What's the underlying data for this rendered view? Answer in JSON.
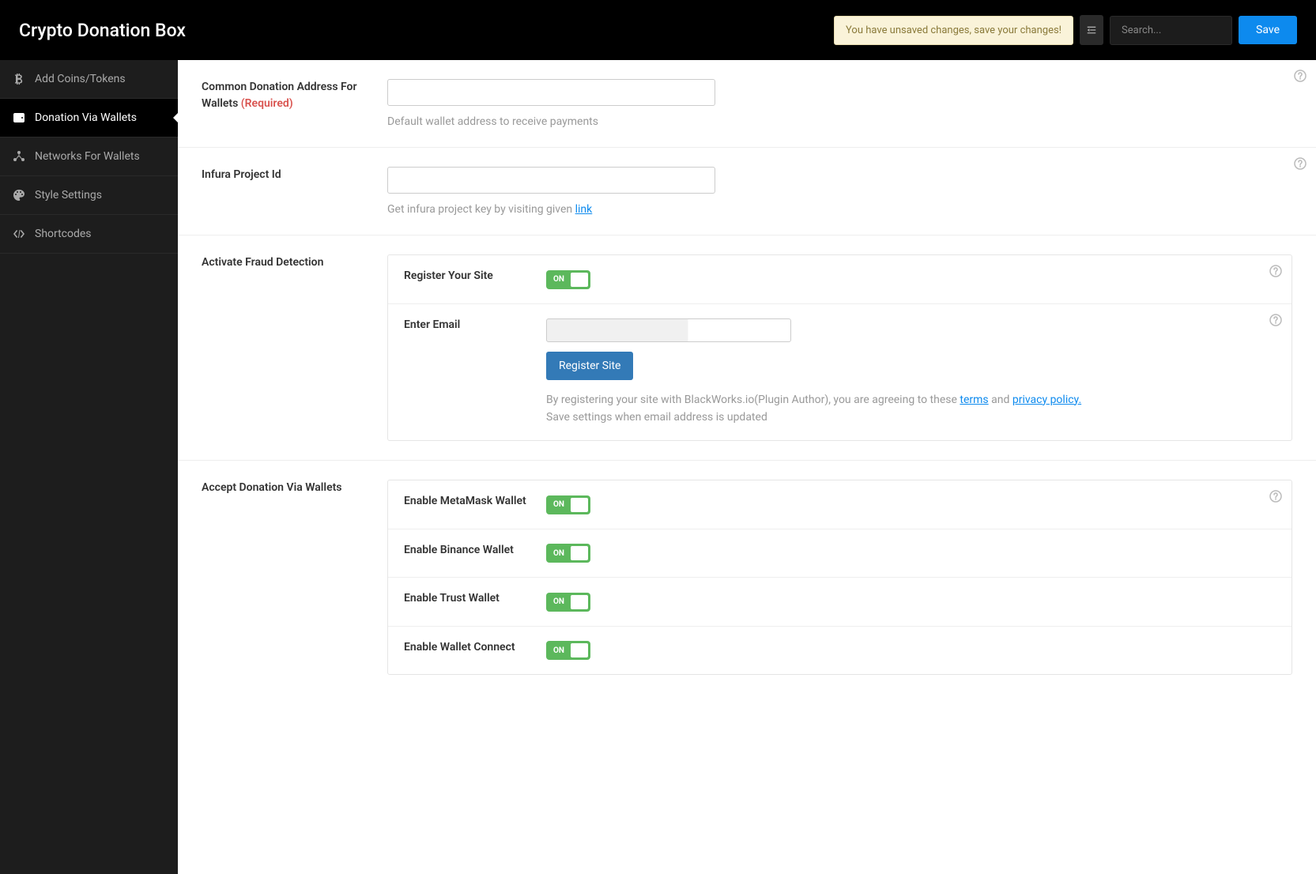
{
  "header": {
    "title": "Crypto Donation Box",
    "unsaved_notice": "You have unsaved changes, save your changes!",
    "search_placeholder": "Search...",
    "save_label": "Save"
  },
  "sidebar": {
    "items": [
      {
        "icon": "bitcoin-icon",
        "label": "Add Coins/Tokens"
      },
      {
        "icon": "wallet-icon",
        "label": "Donation Via Wallets"
      },
      {
        "icon": "network-icon",
        "label": "Networks For Wallets"
      },
      {
        "icon": "palette-icon",
        "label": "Style Settings"
      },
      {
        "icon": "code-icon",
        "label": "Shortcodes"
      }
    ]
  },
  "fields": {
    "donation_address": {
      "label": "Common Donation Address For Wallets",
      "required": "(Required)",
      "help": "Default wallet address to receive payments",
      "value": ""
    },
    "infura": {
      "label": "Infura Project Id",
      "help_prefix": "Get infura project key by visiting given ",
      "help_link": "link",
      "value": ""
    },
    "fraud": {
      "label": "Activate Fraud Detection",
      "register_label": "Register Your Site",
      "toggle_on": "ON",
      "email_label": "Enter Email",
      "email_value": "",
      "register_btn": "Register Site",
      "agree_prefix": "By registering your site with BlackWorks.io(Plugin Author), you are agreeing to these ",
      "terms": "terms",
      "and": " and ",
      "privacy": "privacy policy.",
      "save_note": "Save settings when email address is updated"
    },
    "wallets": {
      "label": "Accept Donation Via Wallets",
      "toggle_on": "ON",
      "items": [
        {
          "label": "Enable MetaMask Wallet"
        },
        {
          "label": "Enable Binance Wallet"
        },
        {
          "label": "Enable Trust Wallet"
        },
        {
          "label": "Enable Wallet Connect"
        }
      ]
    }
  }
}
